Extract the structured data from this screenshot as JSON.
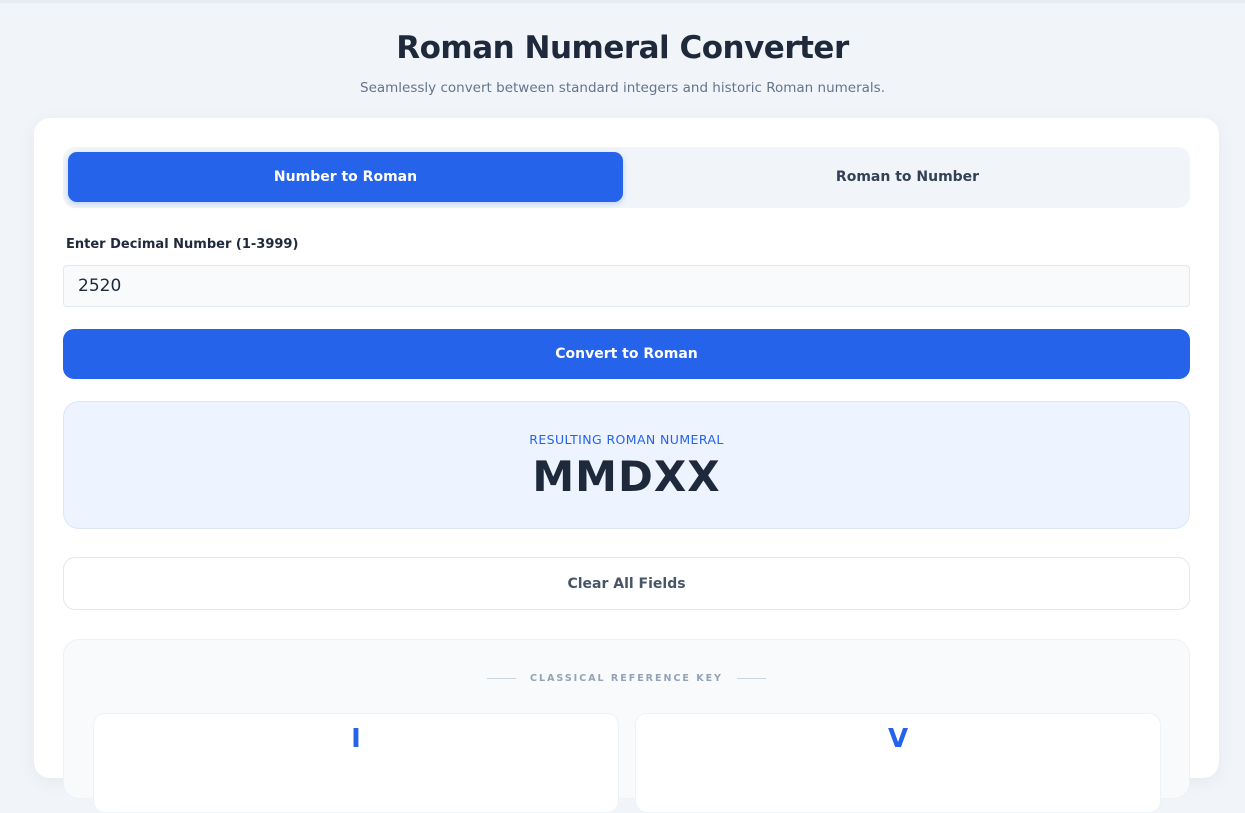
{
  "header": {
    "title": "Roman Numeral Converter",
    "subtitle": "Seamlessly convert between standard integers and historic Roman numerals."
  },
  "tabs": [
    {
      "label": "Number to Roman",
      "active": true
    },
    {
      "label": "Roman to Number",
      "active": false
    }
  ],
  "input": {
    "label": "Enter Decimal Number (1-3999)",
    "value": "2520"
  },
  "convert_button": {
    "label": "Convert to Roman"
  },
  "result": {
    "label": "RESULTING ROMAN NUMERAL",
    "value": "MMDXX"
  },
  "clear_button": {
    "label": "Clear All Fields"
  },
  "reference": {
    "title": "CLASSICAL REFERENCE KEY",
    "items": [
      {
        "symbol": "I"
      },
      {
        "symbol": "V"
      }
    ]
  },
  "colors": {
    "accent": "#2563eb",
    "background": "#f1f5f9",
    "text": "#1e293b"
  }
}
